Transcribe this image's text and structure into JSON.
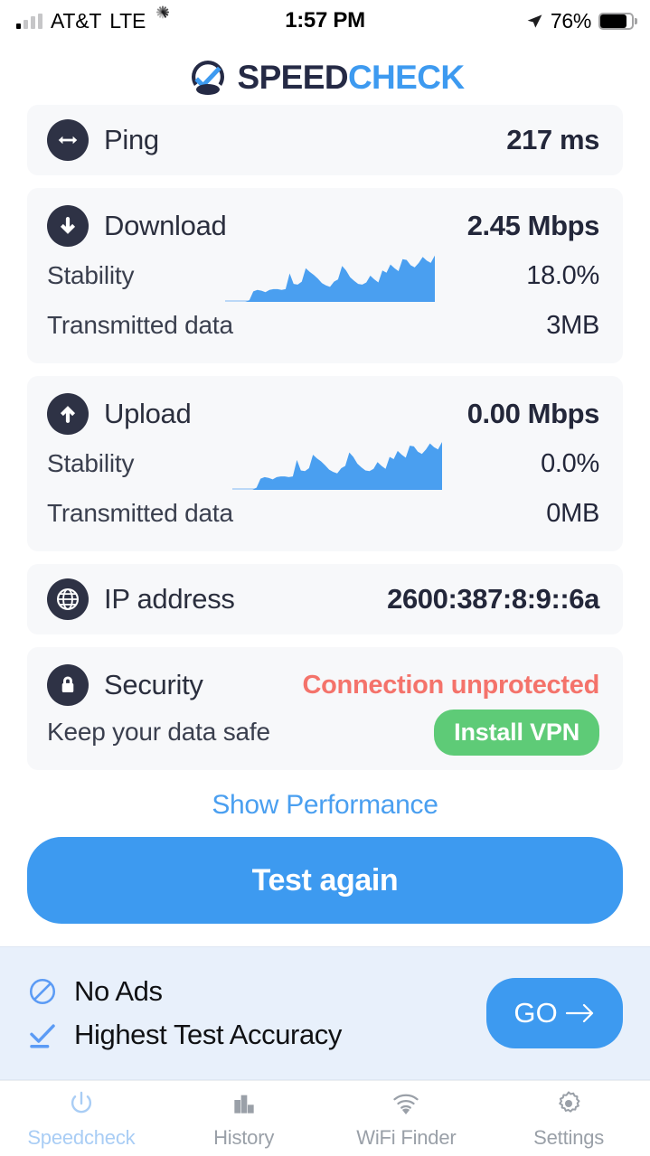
{
  "status_bar": {
    "carrier": "AT&T",
    "network": "LTE",
    "activity_icon": "spinner-icon",
    "time": "1:57 PM",
    "location_icon": "location-arrow-icon",
    "battery_percent": "76%"
  },
  "brand": {
    "name_part1": "SPEED",
    "name_part2": "CHECK",
    "logo_icon": "speedcheck-logo-icon",
    "color_dark": "#252a45",
    "color_blue": "#3d9af0"
  },
  "results": {
    "ping": {
      "icon": "ping-arrows-icon",
      "label": "Ping",
      "value": "217 ms"
    },
    "download": {
      "icon": "arrow-down-icon",
      "label": "Download",
      "value": "2.45 Mbps",
      "stability_label": "Stability",
      "stability_value": "18.0%",
      "transmitted_label": "Transmitted data",
      "transmitted_value": "3MB"
    },
    "upload": {
      "icon": "arrow-up-icon",
      "label": "Upload",
      "value": "0.00 Mbps",
      "stability_label": "Stability",
      "stability_value": "0.0%",
      "transmitted_label": "Transmitted data",
      "transmitted_value": "0MB"
    },
    "ip": {
      "icon": "globe-icon",
      "label": "IP address",
      "value": "2600:387:8:9::6a"
    },
    "security": {
      "icon": "lock-icon",
      "label": "Security",
      "status": "Connection unprotected",
      "status_color": "#f4736b",
      "tagline": "Keep your data safe",
      "button_label": "Install VPN",
      "button_color": "#5ecb77"
    }
  },
  "actions": {
    "show_performance": "Show Performance",
    "test_again": "Test again"
  },
  "promo": {
    "items": [
      {
        "icon": "no-entry-icon",
        "label": "No Ads"
      },
      {
        "icon": "check-underline-icon",
        "label": "Highest Test Accuracy"
      }
    ],
    "cta_label": "GO",
    "cta_icon": "arrow-right-icon",
    "background": "#e8f0fb"
  },
  "tabs": [
    {
      "icon": "power-icon",
      "label": "Speedcheck",
      "active": true
    },
    {
      "icon": "bar-chart-icon",
      "label": "History",
      "active": false
    },
    {
      "icon": "wifi-icon",
      "label": "WiFi Finder",
      "active": false
    },
    {
      "icon": "gear-icon",
      "label": "Settings",
      "active": false
    }
  ],
  "chart_data": [
    {
      "type": "area",
      "title": "Download stability",
      "series": [
        {
          "name": "Download throughput",
          "values": [
            0,
            0,
            0,
            0,
            0,
            0,
            2,
            14,
            16,
            15,
            13,
            16,
            17,
            17,
            16,
            17,
            38,
            24,
            23,
            27,
            45,
            40,
            36,
            31,
            25,
            22,
            20,
            27,
            30,
            48,
            42,
            33,
            28,
            24,
            23,
            26,
            35,
            30,
            26,
            42,
            39,
            50,
            45,
            41,
            57,
            56,
            49,
            46,
            52,
            60,
            55,
            52,
            62
          ]
        }
      ],
      "ylim": [
        0,
        70
      ],
      "grid": false,
      "legend": false,
      "color": "#4a9ff0"
    },
    {
      "type": "area",
      "title": "Upload stability",
      "series": [
        {
          "name": "Upload throughput",
          "values": [
            0,
            0,
            0,
            0,
            0,
            0,
            3,
            15,
            17,
            16,
            14,
            17,
            18,
            18,
            17,
            18,
            40,
            26,
            25,
            29,
            47,
            42,
            38,
            33,
            27,
            24,
            22,
            29,
            32,
            50,
            44,
            35,
            30,
            26,
            25,
            28,
            37,
            32,
            28,
            44,
            41,
            52,
            47,
            43,
            59,
            58,
            51,
            48,
            54,
            62,
            57,
            54,
            64
          ]
        }
      ],
      "ylim": [
        0,
        70
      ],
      "grid": false,
      "legend": false,
      "color": "#4a9ff0"
    }
  ]
}
